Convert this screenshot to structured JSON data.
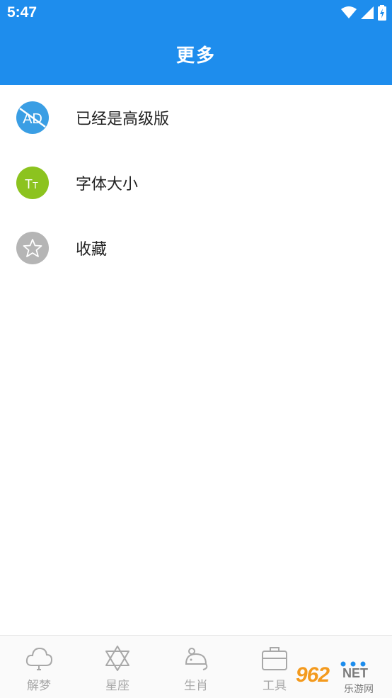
{
  "status_bar": {
    "time": "5:47",
    "icons": [
      "wifi-icon",
      "signal-icon",
      "battery-charging-icon"
    ]
  },
  "header": {
    "title": "更多"
  },
  "menu": {
    "items": [
      {
        "label": "已经是高级版",
        "icon": "no-ads-icon",
        "icon_text": "AD",
        "icon_color": "#3a9ee4"
      },
      {
        "label": "字体大小",
        "icon": "font-size-icon",
        "icon_text": "TT",
        "icon_color": "#8cc31f"
      },
      {
        "label": "收藏",
        "icon": "star-icon",
        "icon_text": "",
        "icon_color": "#b5b5b5"
      }
    ]
  },
  "tabbar": {
    "tabs": [
      {
        "label": "解梦",
        "icon": "cloud-icon"
      },
      {
        "label": "星座",
        "icon": "star-of-david-icon"
      },
      {
        "label": "生肖",
        "icon": "mouse-icon"
      },
      {
        "label": "工具",
        "icon": "briefcase-icon"
      },
      {
        "label": "",
        "icon": "more-dots-icon",
        "active": true
      }
    ],
    "inactive_color": "#a8a8a8",
    "active_color": "#1e8ded"
  },
  "watermark": {
    "brand": "962",
    "suffix": "NET",
    "sub": "乐游网"
  },
  "colors": {
    "primary": "#1e8ded",
    "text": "#222222"
  }
}
